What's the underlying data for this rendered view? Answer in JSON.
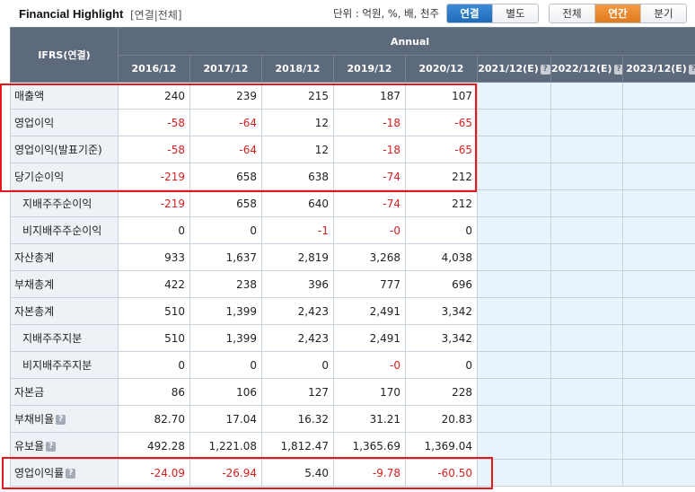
{
  "header": {
    "title": "Financial Highlight",
    "subtitle": "[연결|전체]",
    "unit": "단위 : 억원, %, 배, 천주",
    "scope_buttons": [
      {
        "label": "연결",
        "selected": true
      },
      {
        "label": "별도",
        "selected": false
      }
    ],
    "period_buttons": [
      {
        "label": "전체",
        "selected": false
      },
      {
        "label": "연간",
        "selected": true
      },
      {
        "label": "분기",
        "selected": false
      }
    ]
  },
  "table": {
    "corner_label": "IFRS(연결)",
    "group_label": "Annual",
    "years": [
      "2016/12",
      "2017/12",
      "2018/12",
      "2019/12",
      "2020/12",
      "2021/12(E)",
      "2022/12(E)",
      "2023/12(E)"
    ],
    "help_icon_glyph": "?",
    "rows": [
      {
        "label": "매출액",
        "indent": false,
        "help": false,
        "values": [
          "240",
          "239",
          "215",
          "187",
          "107"
        ]
      },
      {
        "label": "영업이익",
        "indent": false,
        "help": false,
        "values": [
          "-58",
          "-64",
          "12",
          "-18",
          "-65"
        ]
      },
      {
        "label": "영업이익(발표기준)",
        "indent": false,
        "help": false,
        "values": [
          "-58",
          "-64",
          "12",
          "-18",
          "-65"
        ]
      },
      {
        "label": "당기순이익",
        "indent": false,
        "help": false,
        "values": [
          "-219",
          "658",
          "638",
          "-74",
          "212"
        ]
      },
      {
        "label": "지배주주순이익",
        "indent": true,
        "help": false,
        "values": [
          "-219",
          "658",
          "640",
          "-74",
          "212"
        ]
      },
      {
        "label": "비지배주주순이익",
        "indent": true,
        "help": false,
        "values": [
          "0",
          "0",
          "-1",
          "-0",
          "0"
        ]
      },
      {
        "label": "자산총계",
        "indent": false,
        "help": false,
        "values": [
          "933",
          "1,637",
          "2,819",
          "3,268",
          "4,038"
        ]
      },
      {
        "label": "부채총계",
        "indent": false,
        "help": false,
        "values": [
          "422",
          "238",
          "396",
          "777",
          "696"
        ]
      },
      {
        "label": "자본총계",
        "indent": false,
        "help": false,
        "values": [
          "510",
          "1,399",
          "2,423",
          "2,491",
          "3,342"
        ]
      },
      {
        "label": "지배주주지분",
        "indent": true,
        "help": false,
        "values": [
          "510",
          "1,399",
          "2,423",
          "2,491",
          "3,342"
        ]
      },
      {
        "label": "비지배주주지분",
        "indent": true,
        "help": false,
        "values": [
          "0",
          "0",
          "0",
          "-0",
          "0"
        ]
      },
      {
        "label": "자본금",
        "indent": false,
        "help": false,
        "values": [
          "86",
          "106",
          "127",
          "170",
          "228"
        ]
      },
      {
        "label": "부채비율",
        "indent": false,
        "help": true,
        "values": [
          "82.70",
          "17.04",
          "16.32",
          "31.21",
          "20.83"
        ]
      },
      {
        "label": "유보율",
        "indent": false,
        "help": true,
        "values": [
          "492.28",
          "1,221.08",
          "1,812.47",
          "1,365.69",
          "1,369.04"
        ]
      },
      {
        "label": "영업이익률",
        "indent": false,
        "help": true,
        "values": [
          "-24.09",
          "-26.94",
          "5.40",
          "-9.78",
          "-60.50"
        ]
      }
    ]
  },
  "colors": {
    "header_bg": "#5d6a7b",
    "label_bg": "#eef2f6",
    "forecast_bg": "#e9f3fb",
    "negative_text": "#d81e1e",
    "highlight_border": "#e2181c",
    "selected_scope": "#1e6cb8",
    "selected_period": "#e07a1c"
  }
}
